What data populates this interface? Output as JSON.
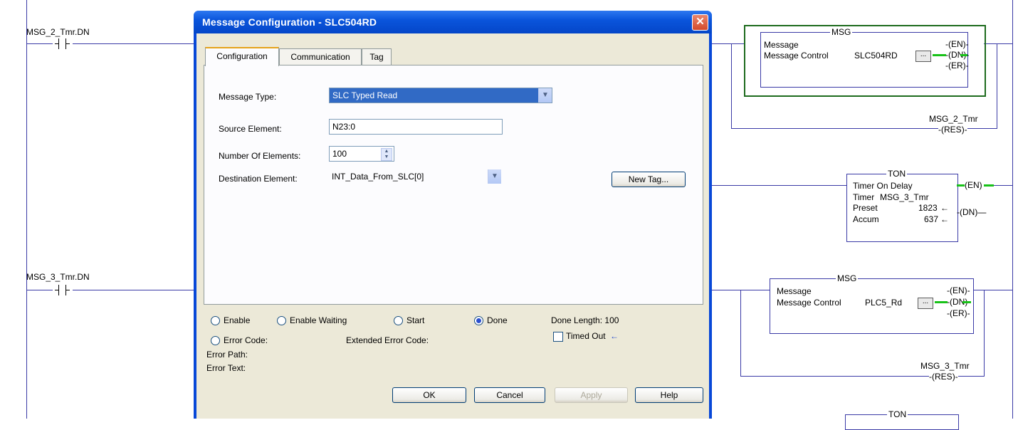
{
  "ladder": {
    "rung1_contact_tag": "MSG_2_Tmr.DN",
    "rung2_contact_tag": "MSG_3_Tmr.DN",
    "msg1": {
      "block_title": "MSG",
      "row1": "Message",
      "row2_label": "Message Control",
      "row2_value": "SLC504RD",
      "ellipsis": "...",
      "out_en": "EN",
      "out_dn": "DN",
      "out_er": "ER"
    },
    "res1": {
      "tag": "MSG_2_Tmr",
      "coil": "RES"
    },
    "ton1": {
      "block_title": "TON",
      "row1": "Timer On Delay",
      "timer_label": "Timer",
      "timer_value": "MSG_3_Tmr",
      "preset_label": "Preset",
      "preset_value": "1823",
      "accum_label": "Accum",
      "accum_value": "637",
      "out_en": "EN",
      "out_dn": "DN"
    },
    "msg2": {
      "block_title": "MSG",
      "row1": "Message",
      "row2_label": "Message Control",
      "row2_value": "PLC5_Rd",
      "ellipsis": "...",
      "out_en": "EN",
      "out_dn": "DN",
      "out_er": "ER"
    },
    "res2": {
      "tag": "MSG_3_Tmr",
      "coil": "RES"
    },
    "ton2_title": "TON"
  },
  "dialog": {
    "title": "Message Configuration - SLC504RD",
    "tabs": [
      {
        "label": "Configuration",
        "active": true
      },
      {
        "label": "Communication",
        "active": false
      },
      {
        "label": "Tag",
        "active": false
      }
    ],
    "fields": {
      "message_type_label": "Message Type:",
      "message_type_value": "SLC Typed Read",
      "source_element_label": "Source Element:",
      "source_element_value": "N23:0",
      "num_elements_label": "Number Of Elements:",
      "num_elements_value": "100",
      "dest_element_label": "Destination Element:",
      "dest_element_value": "INT_Data_From_SLC[0]",
      "new_tag_button": "New Tag..."
    },
    "status": {
      "enable": "Enable",
      "enable_waiting": "Enable Waiting",
      "start": "Start",
      "done": "Done",
      "done_selected": true,
      "done_length": "Done Length: 100",
      "error_code": "Error Code:",
      "extended_error_code": "Extended Error Code:",
      "timed_out": "Timed Out",
      "timed_out_arrow": "←",
      "error_path": "Error Path:",
      "error_text": "Error Text:"
    },
    "buttons": {
      "ok": "OK",
      "cancel": "Cancel",
      "apply": "Apply",
      "help": "Help"
    }
  },
  "colors": {
    "rail": "#3a3aa6",
    "energized": "#19c219",
    "highlight_box": "#1e6b1e",
    "titlebar": "#0a55dc"
  }
}
